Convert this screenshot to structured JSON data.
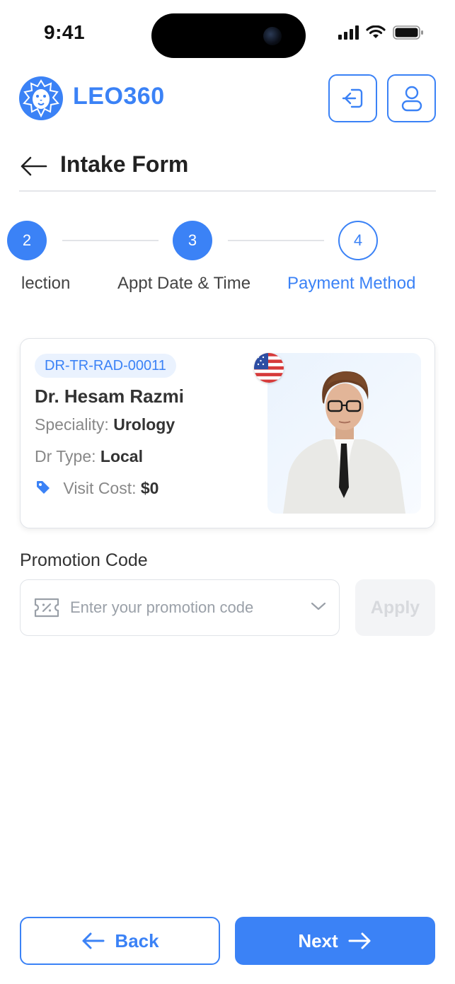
{
  "status_bar": {
    "time": "9:41"
  },
  "brand": {
    "name": "LEO360",
    "accent_color": "#3b82f6"
  },
  "header": {
    "login_icon": "login-icon",
    "profile_icon": "user-icon"
  },
  "page": {
    "title": "Intake Form"
  },
  "stepper": {
    "steps": [
      {
        "number": "2",
        "label": "lection",
        "state": "done"
      },
      {
        "number": "3",
        "label": "Appt Date & Time",
        "state": "done"
      },
      {
        "number": "4",
        "label": "Payment Method",
        "state": "active"
      }
    ]
  },
  "doctor": {
    "id": "DR-TR-RAD-00011",
    "name": "Dr. Hesam Razmi",
    "speciality_label": "Speciality:",
    "speciality": "Urology",
    "type_label": "Dr Type:",
    "type": "Local",
    "cost_label": "Visit Cost:",
    "cost": "$0",
    "flag_icon": "us-flag-icon"
  },
  "promo": {
    "label": "Promotion Code",
    "placeholder": "Enter your promotion code",
    "value": "",
    "apply_label": "Apply"
  },
  "footer": {
    "back_label": "Back",
    "next_label": "Next"
  }
}
